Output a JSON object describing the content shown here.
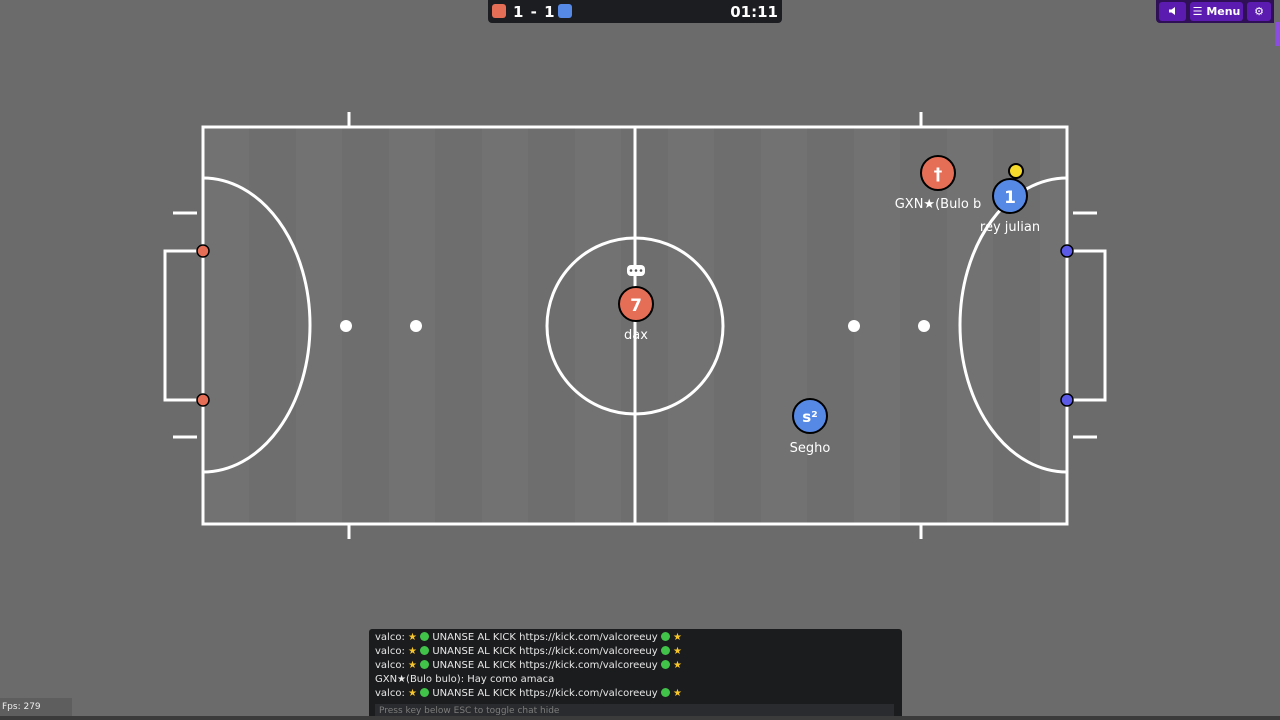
{
  "colors": {
    "red_team": "#e56e56",
    "blue_team": "#5689e5",
    "ball": "#f7dc2b",
    "lines": "#ffffff"
  },
  "scoreboard": {
    "score": "1 - 1",
    "time": "01:11"
  },
  "topright": {
    "sound_icon": "speaker-icon",
    "menu_icon": "hamburger-icon",
    "menu_label": "Menu",
    "settings_icon": "gear-icon"
  },
  "players": [
    {
      "avatar": "†",
      "name": "GXN★(Bulo b",
      "team": "red"
    },
    {
      "avatar": "1",
      "name": "rey julian",
      "team": "blue"
    },
    {
      "avatar": "7",
      "name": "dax",
      "team": "red",
      "typing": true
    },
    {
      "avatar": "s²",
      "name": "Segho",
      "team": "blue"
    }
  ],
  "chat": {
    "messages": [
      {
        "author": "valco",
        "text": "UNANSE AL KICK https://kick.com/valcoreeuy",
        "decorated": true
      },
      {
        "author": "valco",
        "text": "UNANSE AL KICK https://kick.com/valcoreeuy",
        "decorated": true
      },
      {
        "author": "valco",
        "text": "UNANSE AL KICK https://kick.com/valcoreeuy",
        "decorated": true
      },
      {
        "author": "GXN★(Bulo bulo)",
        "text": "Hay como amaca",
        "decorated": false
      },
      {
        "author": "valco",
        "text": "UNANSE AL KICK https://kick.com/valcoreeuy",
        "decorated": true
      }
    ],
    "placeholder": "Press key below ESC to toggle chat hide"
  },
  "fps": "Fps: 279"
}
